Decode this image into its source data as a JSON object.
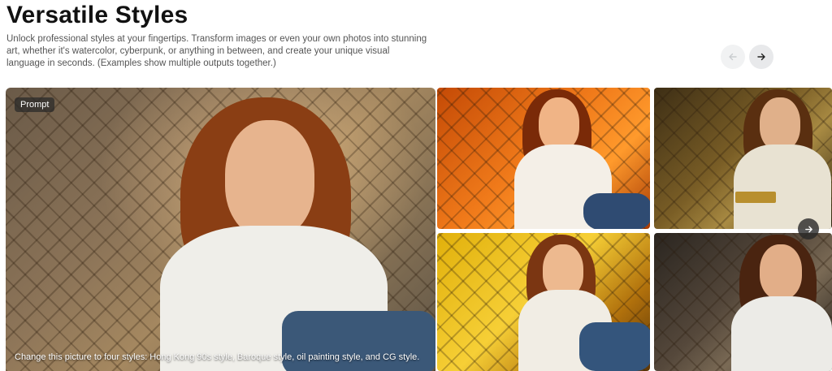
{
  "header": {
    "title": "Versatile Styles",
    "description": "Unlock professional styles at your fingertips. Transform images or even your own photos into stunning art, whether it's watercolor, cyberpunk, or anything in between, and create your unique visual language in seconds. (Examples show multiple outputs together.)"
  },
  "carousel": {
    "prev_icon": "arrow-left-icon",
    "next_icon": "arrow-right-icon",
    "prev_enabled": false
  },
  "example": {
    "prompt_label": "Prompt",
    "prompt_text": "Change this picture to four styles: Hong Kong 90s style, Baroque style, oil painting style, and CG style.",
    "outputs": [
      {
        "style": "Hong Kong 90s style",
        "tone": "#e5661a"
      },
      {
        "style": "Baroque style",
        "tone": "#8a6a2e"
      },
      {
        "style": "oil painting style",
        "tone": "#f0c22a"
      },
      {
        "style": "CG style",
        "tone": "#4a3e32"
      }
    ],
    "thumbs_next_icon": "arrow-right-icon"
  },
  "colors": {
    "accent_dark": "#111111",
    "muted_text": "#555555",
    "nav_bg": "#e8e9eb"
  }
}
